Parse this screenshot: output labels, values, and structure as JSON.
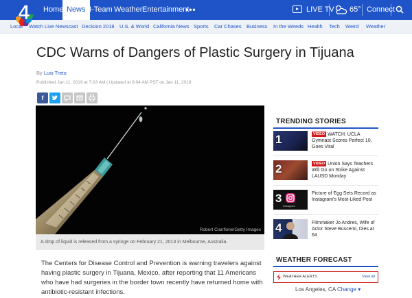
{
  "nav": {
    "items": [
      "Home",
      "News",
      "I-Team",
      "Weather",
      "Entertainment"
    ],
    "more": "•••",
    "live_tv": "LIVE TV",
    "temperature": "65°",
    "connect": "Connect"
  },
  "subnav": {
    "items": [
      "Local",
      "Watch Live Newscast",
      "Decision 2018",
      "U.S. & World",
      "California News",
      "Sports",
      "Car Chases",
      "Business",
      "In the Weeds",
      "Health",
      "Tech",
      "Weird",
      "Weather"
    ]
  },
  "logo": {
    "text": "4"
  },
  "article": {
    "headline": "CDC Warns of Dangers of Plastic Surgery in Tijuana",
    "by": "By",
    "author": "Luis Treto",
    "dateline": "Published Jan 11, 2019 at 7:03 AM | Updated at 9:04 AM PST on Jan 11, 2019",
    "photo_credit": "Robert Cianflone/Getty Images",
    "caption": "A drop of liquid is released from a syringe on February 21, 2013 in Melbourne, Australia.",
    "body": "The Centers for Disease Control and Prevention is warning travelers against having plastic surgery in Tijuana, Mexico, after reporting that 11 Americans who have had surgeries in the border town recently have returned home with antibiotic-resistant infections."
  },
  "share": {
    "facebook": "f",
    "twitter": "t"
  },
  "trending": {
    "title": "TRENDING STORIES",
    "video_badge": "VIDEO",
    "items": [
      {
        "num": "1",
        "video": true,
        "text": "WATCH: UCLA Gymnast Scores Perfect 10, Goes Viral"
      },
      {
        "num": "2",
        "video": true,
        "text": "Union Says Teachers Will Go on Strike Against LAUSD Monday"
      },
      {
        "num": "3",
        "video": false,
        "text": "Picture of Egg Sets Record as Instagram's Most-Liked Post",
        "thumb_label": "Instagram"
      },
      {
        "num": "4",
        "video": false,
        "text": "Filmmaker Jo Andres, Wife of Actor Steve Buscemi, Dies at 64"
      }
    ]
  },
  "weather": {
    "title": "WEATHER FORECAST",
    "alerts_label": "WEATHER ALERTS",
    "view_all": "View all",
    "location": "Los Angeles, CA",
    "change": "Change ▾"
  },
  "colors": {
    "brand_blue": "#1f54c9",
    "alert_red": "#d31b1b"
  }
}
